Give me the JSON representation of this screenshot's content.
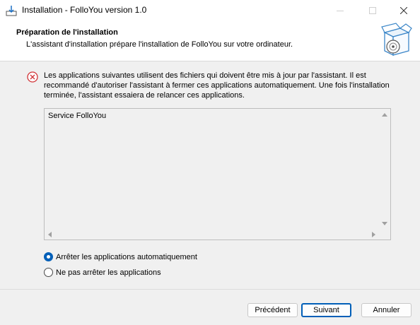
{
  "window": {
    "title": "Installation - FolloYou version 1.0"
  },
  "header": {
    "title": "Préparation de l'installation",
    "subtitle": "L'assistant d'installation prépare l'installation de FolloYou sur votre ordinateur."
  },
  "message": {
    "icon": "error-circle-icon",
    "text": "Les applications suivantes utilisent des fichiers qui doivent être mis à jour par l'assistant. Il est recommandé d'autoriser l'assistant à fermer ces applications automatiquement. Une fois l'installation terminée, l'assistant essaiera de relancer ces applications."
  },
  "apps_list": {
    "items": [
      "Service FolloYou"
    ]
  },
  "options": [
    {
      "label": "Arrêter les applications automatiquement",
      "selected": true
    },
    {
      "label": "Ne pas arrêter les applications",
      "selected": false
    }
  ],
  "buttons": {
    "back": "Précédent",
    "next": "Suivant",
    "cancel": "Annuler"
  },
  "colors": {
    "accent": "#005fb8",
    "error": "#d13438",
    "panel": "#f0f0f0"
  }
}
